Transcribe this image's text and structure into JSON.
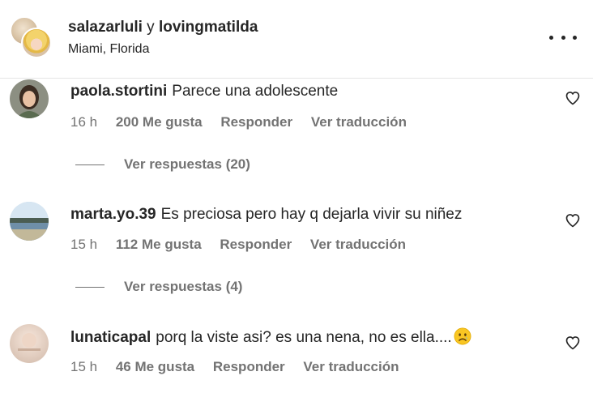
{
  "header": {
    "user1": "salazarluli",
    "conjunction": "y",
    "user2": "lovingmatilda",
    "location": "Miami, Florida"
  },
  "comments": [
    {
      "username": "paola.stortini",
      "text": "Parece una adolescente",
      "time": "16 h",
      "likes": "200 Me gusta",
      "reply": "Responder",
      "translate": "Ver traducción",
      "replies": "Ver respuestas (20)"
    },
    {
      "username": "marta.yo.39",
      "text": "Es preciosa pero hay q dejarla vivir su niñez",
      "time": "15 h",
      "likes": "112 Me gusta",
      "reply": "Responder",
      "translate": "Ver traducción",
      "replies": "Ver respuestas (4)"
    },
    {
      "username": "lunaticapal",
      "text": "porq la viste asi? es una nena, no es ella....",
      "emoji": "sad-face-icon",
      "time": "15 h",
      "likes": "46 Me gusta",
      "reply": "Responder",
      "translate": "Ver traducción"
    }
  ],
  "colors": {
    "text": "#262626",
    "secondary": "#737373",
    "divider": "#e6e6e6"
  }
}
